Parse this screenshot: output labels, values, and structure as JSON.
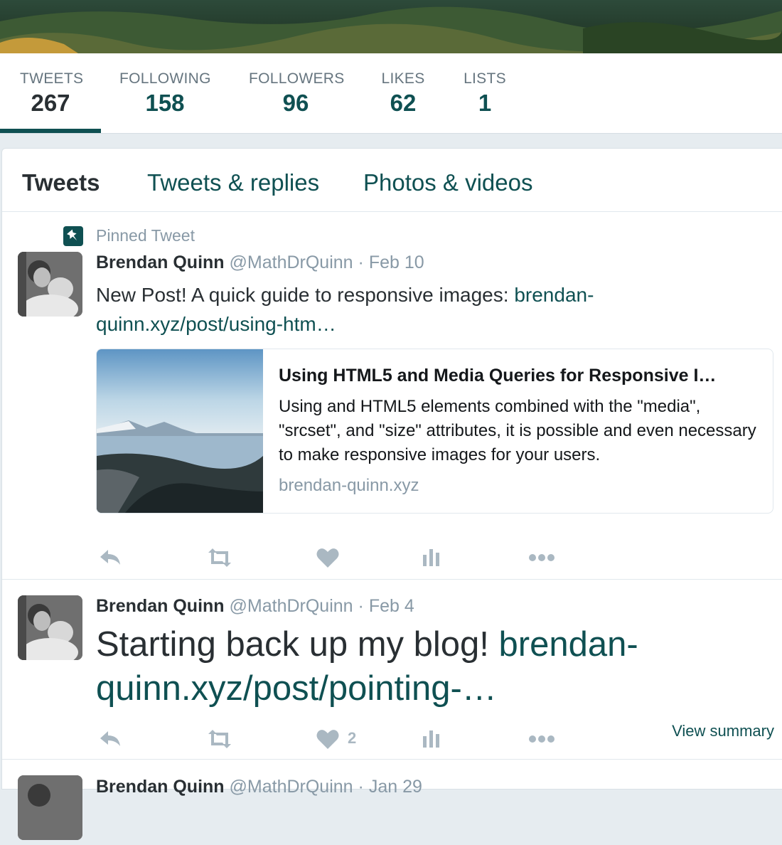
{
  "stats": [
    {
      "label": "TWEETS",
      "value": "267"
    },
    {
      "label": "FOLLOWING",
      "value": "158"
    },
    {
      "label": "FOLLOWERS",
      "value": "96"
    },
    {
      "label": "LIKES",
      "value": "62"
    },
    {
      "label": "LISTS",
      "value": "1"
    }
  ],
  "tabs": [
    "Tweets",
    "Tweets & replies",
    "Photos & videos"
  ],
  "pinned_label": "Pinned Tweet",
  "tweets": [
    {
      "name": "Brendan Quinn",
      "handle": "@MathDrQuinn",
      "separator": "·",
      "date": "Feb 10",
      "text": "New Post!  A quick guide to responsive images:",
      "link": "brendan-quinn.xyz/post/using-htm…",
      "card": {
        "title": "Using HTML5 and Media Queries for Responsive I…",
        "description": "Using and HTML5 elements combined with the \"media\", \"srcset\", and \"size\" attributes, it is possible and even necessary to make responsive images for your users.",
        "domain": "brendan-quinn.xyz"
      },
      "likes": ""
    },
    {
      "name": "Brendan Quinn",
      "handle": "@MathDrQuinn",
      "separator": "·",
      "date": "Feb 4",
      "text": "Starting back up my blog!",
      "link": "brendan-quinn.xyz/post/pointing-…",
      "likes": "2",
      "view_summary": "View summary"
    },
    {
      "name": "Brendan Quinn",
      "handle": "@MathDrQuinn",
      "separator": "·",
      "date": "Jan 29"
    }
  ],
  "colors": {
    "accent": "#0f5052",
    "muted": "#8899a6",
    "icon": "#aab8c2"
  }
}
